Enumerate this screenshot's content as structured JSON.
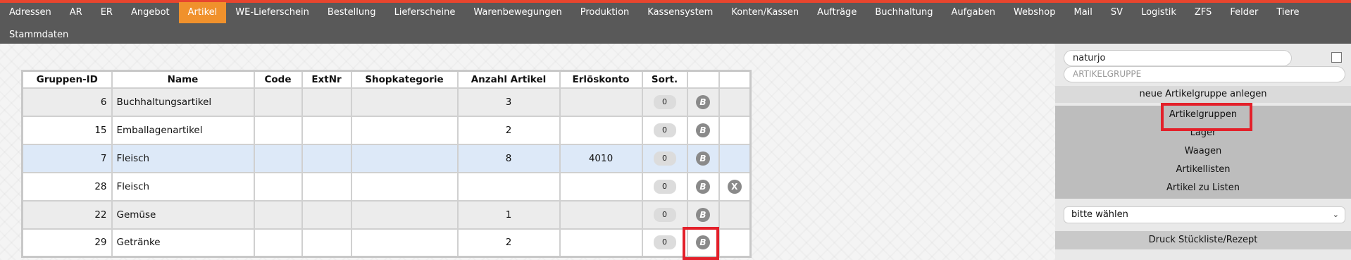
{
  "nav": {
    "row1": [
      "Adressen",
      "AR",
      "ER",
      "Angebot",
      "Artikel",
      "WE-Lieferschein",
      "Bestellung",
      "Lieferscheine",
      "Warenbewegungen",
      "Produktion",
      "Kassensystem",
      "Konten/Kassen",
      "Aufträge",
      "Buchhaltung",
      "Aufgaben",
      "Webshop",
      "Mail",
      "SV",
      "Logistik",
      "ZFS",
      "Felder",
      "Tiere"
    ],
    "row2": [
      "Stammdaten"
    ],
    "active": "Artikel"
  },
  "table": {
    "headers": [
      "Gruppen-ID",
      "Name",
      "Code",
      "ExtNr",
      "Shopkategorie",
      "Anzahl Artikel",
      "Erlöskonto",
      "Sort.",
      "",
      ""
    ],
    "rows": [
      {
        "id": "6",
        "name": "Buchhaltungsartikel",
        "code": "",
        "extnr": "",
        "shop": "",
        "count": "3",
        "konto": "",
        "sort": "0",
        "b": "B",
        "x": ""
      },
      {
        "id": "15",
        "name": "Emballagenartikel",
        "code": "",
        "extnr": "",
        "shop": "",
        "count": "2",
        "konto": "",
        "sort": "0",
        "b": "B",
        "x": ""
      },
      {
        "id": "7",
        "name": "Fleisch",
        "code": "",
        "extnr": "",
        "shop": "",
        "count": "8",
        "konto": "4010",
        "sort": "0",
        "b": "B",
        "x": ""
      },
      {
        "id": "28",
        "name": "Fleisch",
        "code": "",
        "extnr": "",
        "shop": "",
        "count": "",
        "konto": "",
        "sort": "0",
        "b": "B",
        "x": "X"
      },
      {
        "id": "22",
        "name": "Gemüse",
        "code": "",
        "extnr": "",
        "shop": "",
        "count": "1",
        "konto": "",
        "sort": "0",
        "b": "B",
        "x": ""
      },
      {
        "id": "29",
        "name": "Getränke",
        "code": "",
        "extnr": "",
        "shop": "",
        "count": "2",
        "konto": "",
        "sort": "0",
        "b": "B",
        "x": ""
      }
    ]
  },
  "side": {
    "search_value": "naturjo",
    "artikelgruppe_placeholder": "ARTIKELGRUPPE",
    "new_group_label": "neue Artikelgruppe anlegen",
    "menu": [
      "Artikelgruppen",
      "Lager",
      "Waagen",
      "Artikellisten",
      "Artikel zu Listen"
    ],
    "select_value": "bitte wählen",
    "druck_label": "Druck Stückliste/Rezept"
  }
}
